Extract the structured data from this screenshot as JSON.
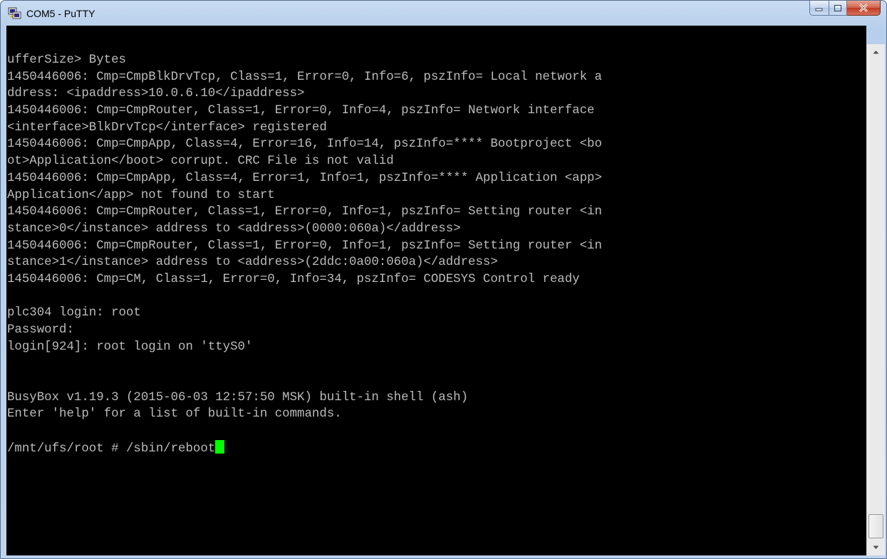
{
  "window": {
    "title": "COM5 - PuTTY",
    "icons": {
      "app": "putty-app-icon",
      "minimize": "minimize-icon",
      "maximize": "maximize-icon",
      "close": "close-icon"
    }
  },
  "terminal": {
    "lines": [
      "ufferSize> Bytes",
      "1450446006: Cmp=CmpBlkDrvTcp, Class=1, Error=0, Info=6, pszInfo= Local network a",
      "ddress: <ipaddress>10.0.6.10</ipaddress>",
      "1450446006: Cmp=CmpRouter, Class=1, Error=0, Info=4, pszInfo= Network interface",
      "<interface>BlkDrvTcp</interface> registered",
      "1450446006: Cmp=CmpApp, Class=4, Error=16, Info=14, pszInfo=**** Bootproject <bo",
      "ot>Application</boot> corrupt. CRC File is not valid",
      "1450446006: Cmp=CmpApp, Class=4, Error=1, Info=1, pszInfo=**** Application <app>",
      "Application</app> not found to start",
      "1450446006: Cmp=CmpRouter, Class=1, Error=0, Info=1, pszInfo= Setting router <in",
      "stance>0</instance> address to <address>(0000:060a)</address>",
      "1450446006: Cmp=CmpRouter, Class=1, Error=0, Info=1, pszInfo= Setting router <in",
      "stance>1</instance> address to <address>(2ddc:0a00:060a)</address>",
      "1450446006: Cmp=CM, Class=1, Error=0, Info=34, pszInfo= CODESYS Control ready",
      "",
      "plc304 login: root",
      "Password:",
      "login[924]: root login on 'ttyS0'",
      "",
      "",
      "BusyBox v1.19.3 (2015-06-03 12:57:50 MSK) built-in shell (ash)",
      "Enter 'help' for a list of built-in commands.",
      ""
    ],
    "prompt": "/mnt/ufs/root # ",
    "command": "/sbin/reboot",
    "colors": {
      "background": "#000000",
      "text": "#bbbbbb",
      "cursor": "#00ff00"
    }
  },
  "scrollbar": {
    "icons": {
      "up": "scroll-up-arrow-icon",
      "down": "scroll-down-arrow-icon"
    }
  }
}
